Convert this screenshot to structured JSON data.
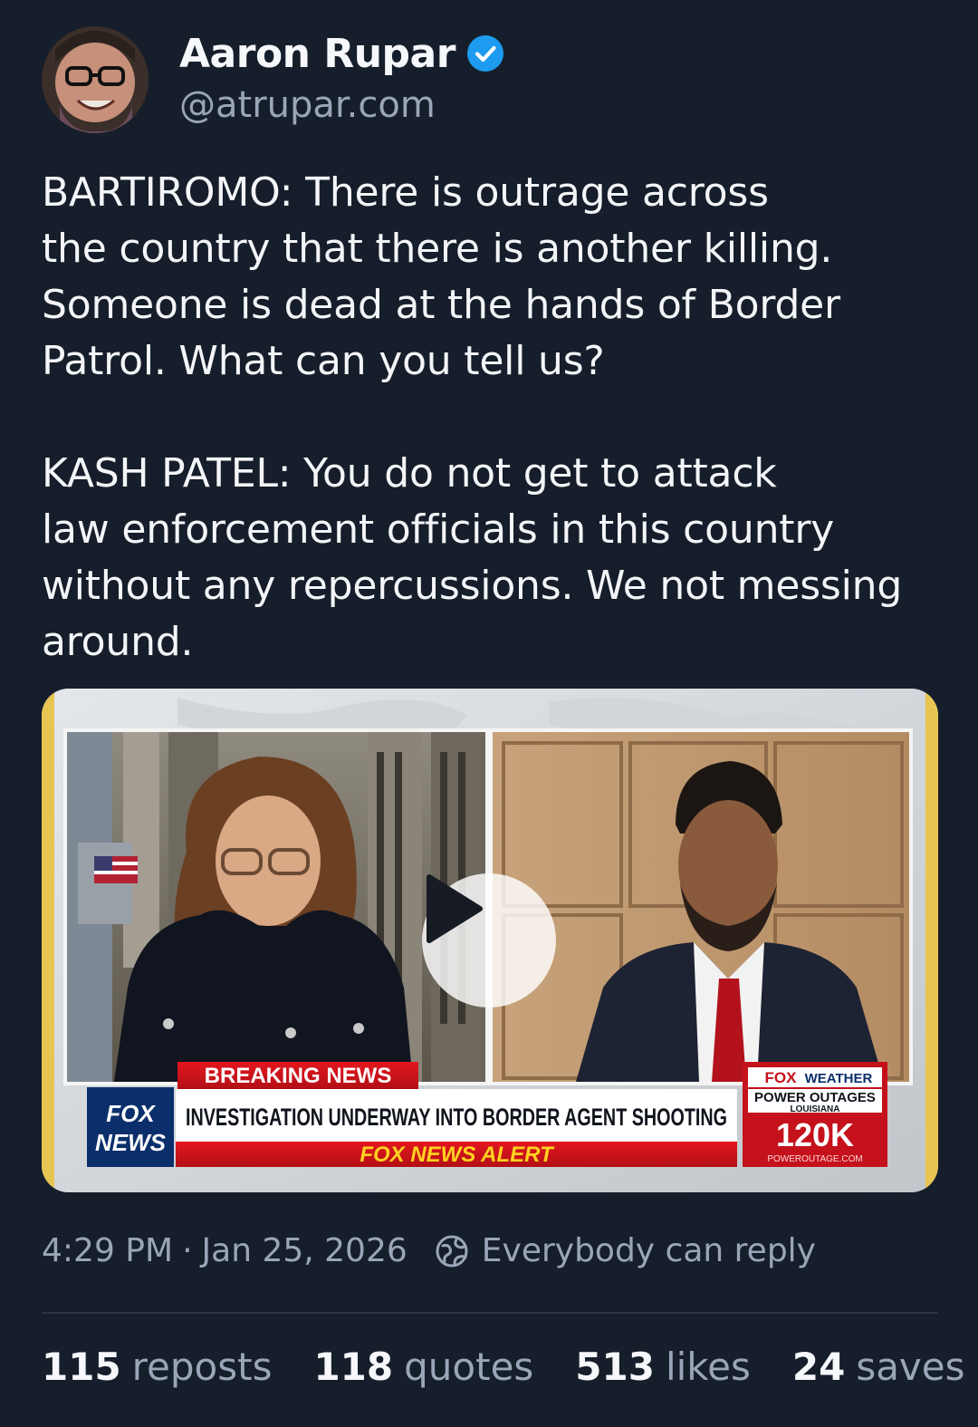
{
  "author": {
    "display_name": "Aaron Rupar",
    "handle": "@atrupar.com",
    "verified": true
  },
  "post": {
    "text": "BARTIROMO: There is outrage across\nthe country that there is another killing.\nSomeone is dead at the hands of Border\nPatrol. What can you tell us?\n\nKASH PATEL: You do not get to attack\nlaw enforcement officials in this country\nwithout any repercussions. We not messing\naround."
  },
  "video": {
    "banner_breaking": "BREAKING NEWS",
    "headline": "INVESTIGATION UNDERWAY INTO BORDER AGENT SHOOTING",
    "alert": "FOX NEWS ALERT",
    "logo_top": "FOX",
    "logo_bottom": "NEWS",
    "weather_brand_a": "FOX",
    "weather_brand_b": "WEATHER",
    "weather_title": "POWER OUTAGES",
    "weather_region": "LOUISIANA",
    "weather_value": "120K",
    "weather_source": "POWEROUTAGE.COM",
    "play_icon": "play-icon"
  },
  "meta": {
    "time": "4:29 PM",
    "separator": "·",
    "date": "Jan 25, 2026",
    "reply_setting": "Everybody can reply"
  },
  "stats": {
    "reposts_count": "115",
    "reposts_label": "reposts",
    "quotes_count": "118",
    "quotes_label": "quotes",
    "likes_count": "513",
    "likes_label": "likes",
    "saves_count": "24",
    "saves_label": "saves"
  },
  "colors": {
    "background": "#161e2b",
    "verified_blue": "#1d9bf0",
    "muted_text": "#9aa6b8",
    "fox_red": "#c8102e",
    "fox_blue": "#003d7a"
  }
}
